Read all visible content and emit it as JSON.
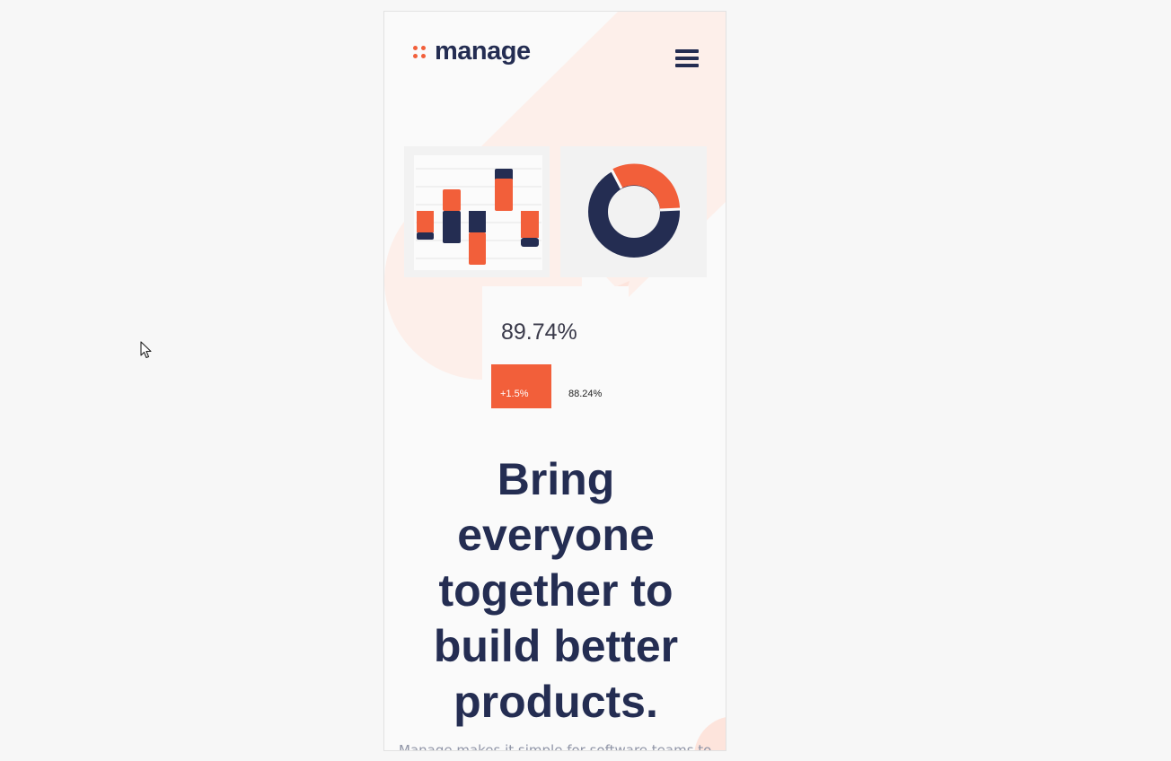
{
  "brand": {
    "logo_text": "manage",
    "accent": "#f25f3a",
    "navy": "#242d52"
  },
  "header": {
    "menu_icon": "hamburger-menu-icon"
  },
  "hero": {
    "stat_main": "89.74%",
    "badge_change": "+1.5%",
    "stat_secondary": "88.24%",
    "headline": "Bring everyone together to build better products.",
    "subtext": "Manage makes it simple for software teams to"
  },
  "cursor": {
    "icon": "mouse-pointer-icon"
  }
}
